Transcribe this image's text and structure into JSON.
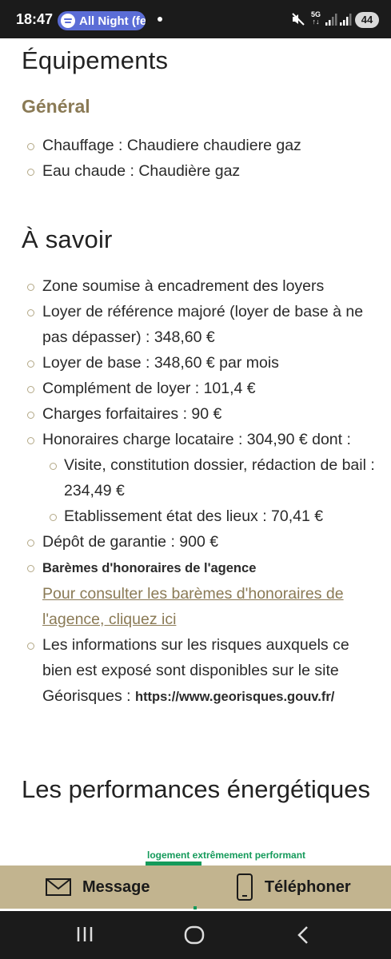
{
  "status_bar": {
    "time": "18:47",
    "media_pill": "All Night (fe",
    "network": "5G",
    "battery": "44",
    "icons": [
      "spotify-icon",
      "mute-icon",
      "signal-icon",
      "battery-icon"
    ]
  },
  "sections": {
    "equipements": {
      "title": "Équipements",
      "subtitle": "Général",
      "items": [
        "Chauffage : Chaudiere chaudiere gaz",
        "Eau chaude : Chaudière gaz"
      ]
    },
    "a_savoir": {
      "title": "À savoir",
      "items": [
        "Zone soumise à encadrement des loyers",
        "Loyer de référence majoré (loyer de base à ne pas dépasser) : 348,60 €",
        "Loyer de base : 348,60 € par mois",
        "Complément de loyer : 101,4 €",
        "Charges forfaitaires : 90 €",
        "Honoraires charge locataire : 304,90 € dont :"
      ],
      "sub_items": [
        "Visite, constitution dossier, rédaction de bail : 234,49 €",
        "Etablissement état des lieux : 70,41 €"
      ],
      "depot": "Dépôt de garantie : 900 €",
      "baremes_title": "Barèmes d'honoraires de l'agence",
      "baremes_link": "Pour consulter les barèmes d'honoraires de l'agence, cliquez ici",
      "risques_text": "Les informations sur les risques auxquels ce bien est exposé sont disponibles sur le site Géorisques :",
      "risques_url": "https://www.georisques.gouv.fr/"
    },
    "performances": {
      "title": "Les performances énergétiques",
      "energy_label": "logement extrêmement performant",
      "energy_color": "#149a5a"
    }
  },
  "action_bar": {
    "message_label": "Message",
    "phone_label": "Téléphoner",
    "background": "#c2b48f"
  },
  "colors": {
    "accent": "#8a7a55",
    "heading": "#222222"
  }
}
